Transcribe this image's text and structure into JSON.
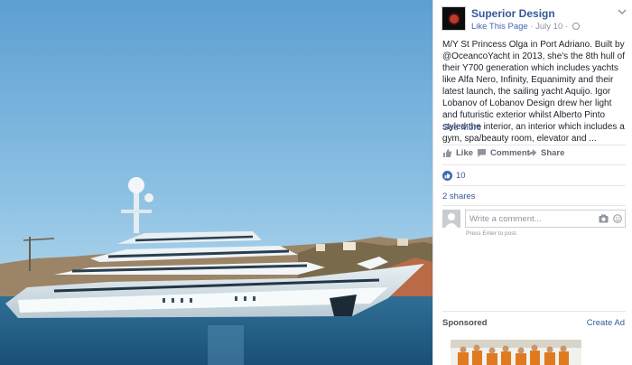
{
  "page": {
    "name": "Superior Design",
    "like_page": "Like This Page",
    "separator": "·",
    "date": "July 10",
    "separator2": "·"
  },
  "post": {
    "text": "M/Y St Princess Olga in Port Adriano. Built by @OceancoYacht in 2013, she's the 8th hull of their Y700 generation which includes yachts like Alfa Nero, Infinity, Equanimity and their latest launch, the sailing yacht Aquijo. Igor Lobanov of Lobanov Design drew her light and futuristic exterior whilst Alberto Pinto styled the interior, an interior which includes a gym, spa/beauty room, elevator and ...",
    "see_more": "See More"
  },
  "actions": {
    "like": "Like",
    "comment": "Comment",
    "share": "Share"
  },
  "stats": {
    "likes": "10",
    "shares": "2 shares"
  },
  "comment": {
    "placeholder": "Write a comment...",
    "hint": "Press Enter to post."
  },
  "ads": {
    "sponsored": "Sponsored",
    "create_ad": "Create Ad"
  },
  "colors": {
    "link": "#365899",
    "accent": "#4267b2",
    "muted": "#90949c"
  },
  "icons": [
    "chevron-down-icon",
    "globe-icon",
    "like-icon",
    "comment-icon",
    "share-icon",
    "camera-icon",
    "emoji-icon",
    "avatar-placeholder-icon"
  ]
}
